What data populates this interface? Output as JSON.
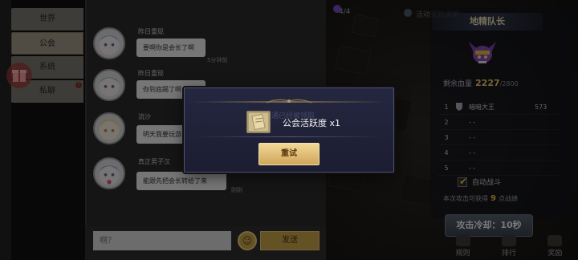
{
  "chat": {
    "tabs": [
      {
        "label": "世界",
        "active": false
      },
      {
        "label": "公会",
        "active": true
      },
      {
        "label": "系统",
        "active": false
      },
      {
        "label": "私聊",
        "active": false,
        "badge": "!"
      }
    ],
    "messages": [
      {
        "name": "昨日重现",
        "text": "要啊你是会长了啊",
        "time": "5分钟前"
      },
      {
        "name": "昨日重现",
        "text": "你到底踢了啊",
        "time": ""
      },
      {
        "name": "流沙",
        "text": "明天我要玩游",
        "time": ""
      },
      {
        "name": "真正男子汉",
        "text": "能跟先把会长转给了来",
        "time": "刚刚"
      }
    ],
    "input_placeholder": "啊？",
    "send_label": "发送"
  },
  "world": {
    "stage_counter": "4/4",
    "activity_text": "活动奖励说明"
  },
  "boss": {
    "title": "地精队长",
    "hp_label": "剩余血量",
    "hp_current": "2227",
    "hp_max": "/2800",
    "ranking": [
      {
        "rank": "1",
        "name": "暗暗大王",
        "score": "573",
        "has_icon": true
      },
      {
        "rank": "2",
        "name": "- -",
        "score": "",
        "has_icon": false
      },
      {
        "rank": "3",
        "name": "- -",
        "score": "",
        "has_icon": false
      },
      {
        "rank": "4",
        "name": "- -",
        "score": "",
        "has_icon": false
      },
      {
        "rank": "5",
        "name": "- -",
        "score": "",
        "has_icon": false
      }
    ],
    "auto_battle_label": "自动战斗",
    "auto_battle_checked": true,
    "reward_prefix": "本次攻击可获得",
    "reward_value": "9",
    "reward_suffix": "点战绩",
    "cooldown_label": "攻击冷却：10秒",
    "nav": [
      "规则",
      "排行",
      "奖励"
    ]
  },
  "modal": {
    "reward_text": "公会活跃度 x1",
    "retry_label": "重试",
    "ghost_text": "通已经被领取"
  },
  "colors": {
    "gold": "#cfa55a",
    "modal_bg": "#1f2035",
    "hp_value": "#e8c66a"
  }
}
